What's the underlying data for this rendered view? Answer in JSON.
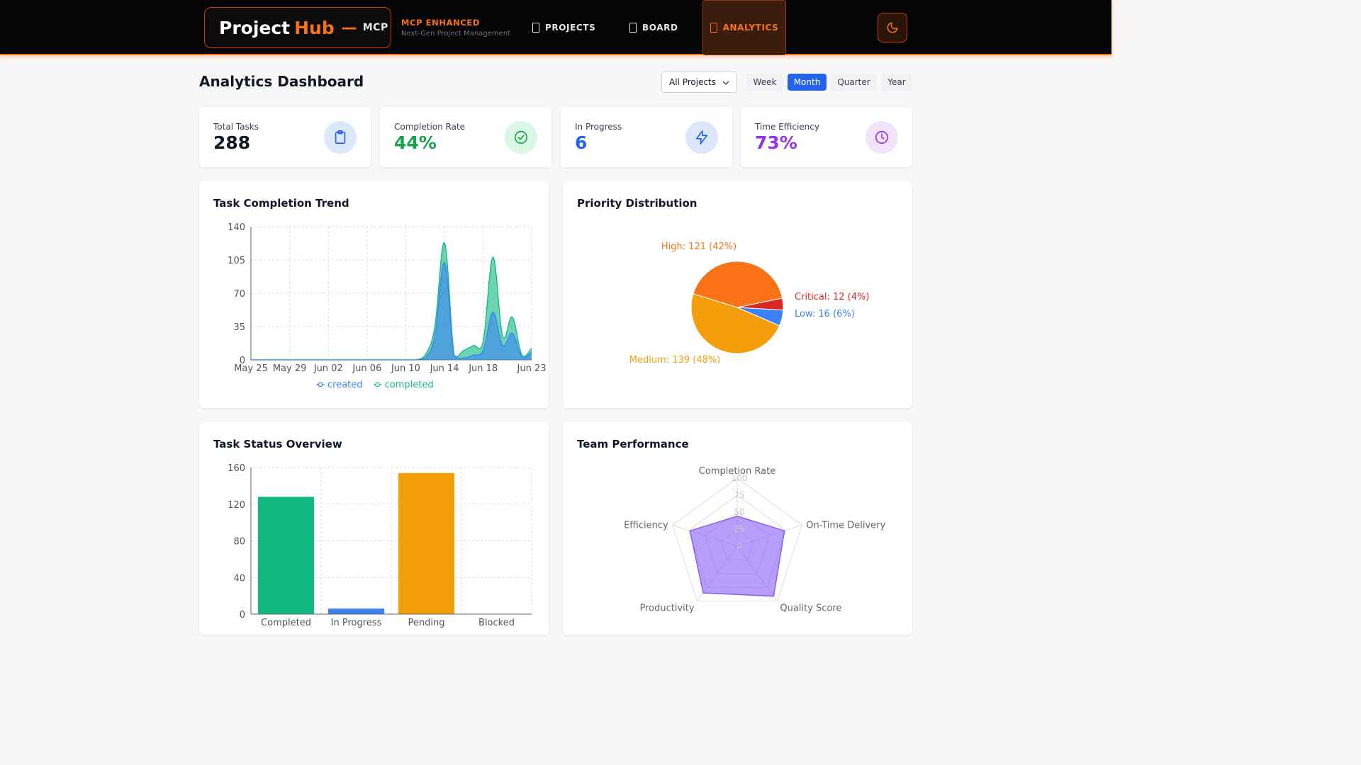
{
  "header": {
    "brand_project": "Project",
    "brand_hub": "Hub",
    "brand_dash": "—",
    "brand_mcp": "MCP",
    "tagline_title": "MCP ENHANCED",
    "tagline_sub": "Next-Gen Project Management",
    "nav": {
      "projects": "PROJECTS",
      "board": "BOARD",
      "analytics": "ANALYTICS"
    },
    "theme_icon": "moon-icon"
  },
  "page": {
    "title": "Analytics Dashboard",
    "project_filter": "All Projects",
    "periods": {
      "week": "Week",
      "month": "Month",
      "quarter": "Quarter",
      "year": "Year"
    },
    "active_period": "Month"
  },
  "stats": {
    "total_tasks": {
      "label": "Total Tasks",
      "value": "288",
      "icon": "clipboard-icon"
    },
    "completion_rate": {
      "label": "Completion Rate",
      "value": "44%",
      "icon": "check-circle-icon"
    },
    "in_progress": {
      "label": "In Progress",
      "value": "6",
      "icon": "lightning-icon"
    },
    "time_efficiency": {
      "label": "Time Efficiency",
      "value": "73%",
      "icon": "clock-icon"
    }
  },
  "cards": {
    "trend_title": "Task Completion Trend",
    "priority_title": "Priority Distribution",
    "status_title": "Task Status Overview",
    "team_title": "Team Performance"
  },
  "colors": {
    "accent": "#f97316",
    "blue": "#3b82f6",
    "green": "#10b981",
    "amber": "#f59e0b",
    "red": "#dc2626",
    "purple": "#9333ea"
  },
  "chart_data": [
    {
      "type": "area",
      "title": "Task Completion Trend",
      "x_labels": [
        "May 25",
        "May 29",
        "Jun 02",
        "Jun 06",
        "Jun 10",
        "Jun 14",
        "Jun 18",
        "Jun 23"
      ],
      "ylim": [
        0,
        140
      ],
      "yticks": [
        0,
        35,
        70,
        105,
        140
      ],
      "x": [
        "May 25",
        "May 26",
        "May 27",
        "May 28",
        "May 29",
        "May 30",
        "May 31",
        "Jun 01",
        "Jun 02",
        "Jun 03",
        "Jun 04",
        "Jun 05",
        "Jun 06",
        "Jun 07",
        "Jun 08",
        "Jun 09",
        "Jun 10",
        "Jun 11",
        "Jun 12",
        "Jun 13",
        "Jun 14",
        "Jun 15",
        "Jun 16",
        "Jun 17",
        "Jun 18",
        "Jun 19",
        "Jun 20",
        "Jun 21",
        "Jun 22",
        "Jun 23"
      ],
      "series": [
        {
          "name": "created",
          "color": "#3b82f6",
          "values": [
            0,
            0,
            0,
            0,
            0,
            0,
            0,
            0,
            0,
            0,
            0,
            0,
            0,
            0,
            0,
            0,
            0,
            0,
            2,
            25,
            102,
            5,
            2,
            5,
            10,
            50,
            15,
            28,
            3,
            8
          ]
        },
        {
          "name": "completed",
          "color": "#10b981",
          "values": [
            0,
            0,
            0,
            0,
            0,
            0,
            0,
            0,
            0,
            0,
            0,
            0,
            0,
            0,
            0,
            0,
            0,
            0,
            5,
            35,
            123,
            5,
            10,
            15,
            20,
            108,
            25,
            45,
            5,
            12
          ]
        }
      ],
      "legend": "bottom"
    },
    {
      "type": "pie",
      "title": "Priority Distribution",
      "slices": [
        {
          "label": "High: 121 (42%)",
          "value": 121,
          "color": "#f97316"
        },
        {
          "label": "Critical: 12 (4%)",
          "value": 12,
          "color": "#dc2626"
        },
        {
          "label": "Low: 16 (6%)",
          "value": 16,
          "color": "#3b82f6"
        },
        {
          "label": "Medium: 139 (48%)",
          "value": 139,
          "color": "#f59e0b"
        }
      ]
    },
    {
      "type": "bar",
      "title": "Task Status Overview",
      "categories": [
        "Completed",
        "In Progress",
        "Pending",
        "Blocked"
      ],
      "values": [
        128,
        6,
        154,
        0
      ],
      "colors": [
        "#10b981",
        "#3b82f6",
        "#f59e0b",
        "#dc2626"
      ],
      "ylim": [
        0,
        160
      ],
      "yticks": [
        0,
        40,
        80,
        120,
        160
      ]
    },
    {
      "type": "radar",
      "title": "Team Performance",
      "axes": [
        "Completion Rate",
        "On-Time Delivery",
        "Quality Score",
        "Productivity",
        "Efficiency"
      ],
      "values": [
        44,
        73,
        91,
        85,
        73
      ],
      "rticks": [
        0,
        25,
        50,
        75,
        100
      ],
      "rmax": 100,
      "color": "#8b5cf6"
    }
  ]
}
